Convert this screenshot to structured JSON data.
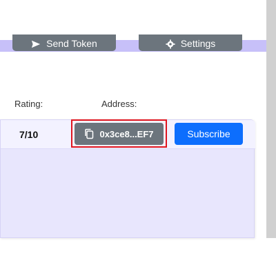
{
  "nav": {
    "send_label": "Send Token",
    "settings_label": "Settings"
  },
  "table": {
    "headers": {
      "rating": "Rating:",
      "address": "Address:"
    },
    "rows": [
      {
        "rating": "7/10",
        "address": "0x3ce8...EF7",
        "action": "Subscribe"
      }
    ]
  },
  "colors": {
    "nav_bg": "#c7c0f9",
    "panel_bg": "#e8e6fd",
    "address_button": "#6c757d",
    "subscribe_button": "#0d6efd",
    "highlight": "#e0141e"
  },
  "icons": {
    "send": "send-icon",
    "settings": "gear-icon",
    "copy": "copy-icon"
  }
}
